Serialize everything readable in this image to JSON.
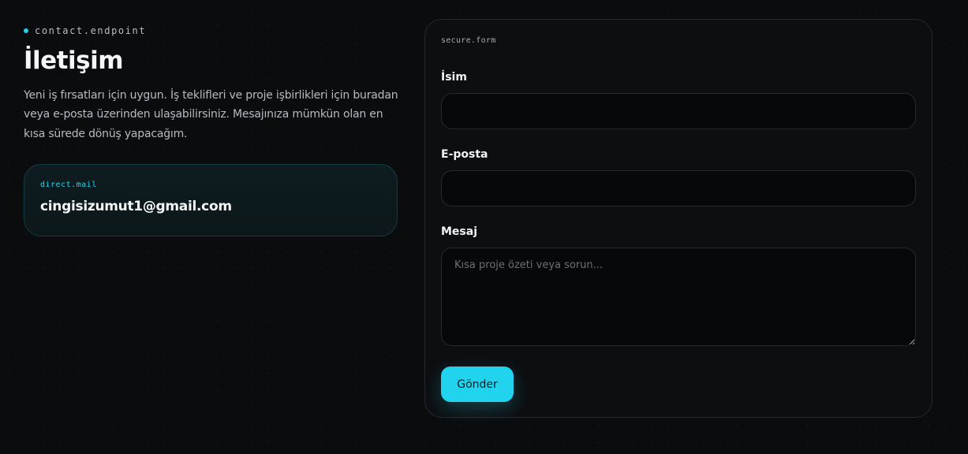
{
  "header": {
    "eyebrow": "contact.endpoint",
    "title": "İletişim",
    "description": "Yeni iş fırsatları için uygun. İş teklifleri ve proje işbirlikleri için buradan veya e-posta üzerinden ulaşabilirsiniz. Mesajınıza mümkün olan en kısa sürede dönüş yapacağım."
  },
  "mail_card": {
    "tag": "direct.mail",
    "email": "cingisizumut1@gmail.com"
  },
  "form": {
    "tag": "secure.form",
    "name_label": "İsim",
    "name_value": "",
    "email_label": "E-posta",
    "email_value": "",
    "message_label": "Mesaj",
    "message_value": "",
    "message_placeholder": "Kısa proje özeti veya sorun...",
    "submit_label": "Gönder"
  },
  "colors": {
    "accent": "#22d3ee",
    "background": "#0b0c0e",
    "card": "#0d0e10"
  }
}
